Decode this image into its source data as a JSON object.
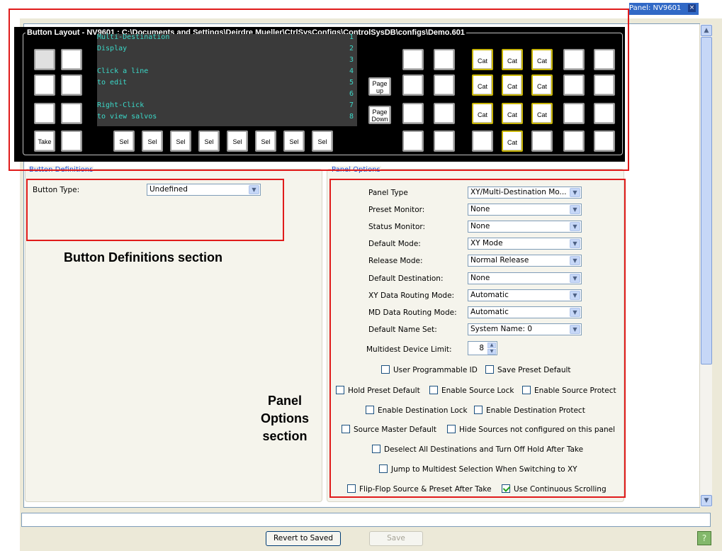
{
  "panel_tab": {
    "label": "Panel: NV9601",
    "close": "×"
  },
  "button_layout": {
    "title": "Button Layout - NV9601 : C:\\Documents and Settings\\Deirdre Mueller\\CtrlSysConfigs\\ControlSysDB\\configs\\Demo.601",
    "display_lines": [
      "Multi-Destination",
      "Display",
      "",
      "Click a line",
      "to edit",
      "",
      "Right-Click",
      "to view salvos"
    ],
    "display_numbers": [
      "1",
      "2",
      "3",
      "4",
      "5",
      "6",
      "7",
      "8"
    ],
    "take": "Take",
    "sel": "Sel",
    "page_up": [
      "Page",
      "up"
    ],
    "page_down": [
      "Page",
      "Down"
    ],
    "cat": "Cat"
  },
  "button_definitions": {
    "title": "Button Definitions",
    "button_type_label": "Button Type:",
    "button_type_value": "Undefined"
  },
  "panel_options": {
    "title": "Panel Options",
    "fields": [
      {
        "label": "Panel Type",
        "value": "XY/Multi-Destination Mo..."
      },
      {
        "label": "Preset Monitor:",
        "value": "None"
      },
      {
        "label": "Status Monitor:",
        "value": "None"
      },
      {
        "label": "Default Mode:",
        "value": "XY Mode"
      },
      {
        "label": "Release Mode:",
        "value": "Normal Release"
      },
      {
        "label": "Default Destination:",
        "value": "None"
      },
      {
        "label": "XY Data Routing Mode:",
        "value": "Automatic"
      },
      {
        "label": "MD Data Routing Mode:",
        "value": "Automatic"
      },
      {
        "label": "Default Name Set:",
        "value": "System Name: 0"
      }
    ],
    "multidest_label": "Multidest Device Limit:",
    "multidest_value": "8",
    "checkboxes": [
      {
        "label": "User Programmable ID",
        "checked": false
      },
      {
        "label": "Save Preset Default",
        "checked": false
      },
      {
        "label": "Hold Preset Default",
        "checked": false
      },
      {
        "label": "Enable Source Lock",
        "checked": false
      },
      {
        "label": "Enable Source Protect",
        "checked": false
      },
      {
        "label": "Enable Destination Lock",
        "checked": false
      },
      {
        "label": "Enable Destination Protect",
        "checked": false
      },
      {
        "label": "Source Master Default",
        "checked": false
      },
      {
        "label": "Hide Sources not configured on this panel",
        "checked": false
      },
      {
        "label": "Deselect All Destinations and Turn Off Hold After Take",
        "checked": false
      },
      {
        "label": "Jump to Multidest Selection When Switching to XY",
        "checked": false
      },
      {
        "label": "Flip-Flop Source & Preset After Take",
        "checked": false
      },
      {
        "label": "Use Continuous Scrolling",
        "checked": true
      }
    ]
  },
  "annotations": {
    "button_definitions": "Button Definitions section",
    "panel_options": [
      "Panel",
      "Options",
      "section"
    ]
  },
  "footer": {
    "revert": "Revert to Saved",
    "save": "Save",
    "help": "?"
  },
  "colors": {
    "accent": "#3169c6",
    "annotation_red": "#e01b1b",
    "display_text": "#3ad9c9",
    "cat_border": "#c8b400",
    "checkbox_green": "#21a121"
  },
  "icons": {
    "combo_arrow": "chevron-down-icon",
    "scroll_up": "chevron-up-icon",
    "scroll_down": "chevron-down-icon",
    "help": "help-icon",
    "close": "close-icon"
  }
}
